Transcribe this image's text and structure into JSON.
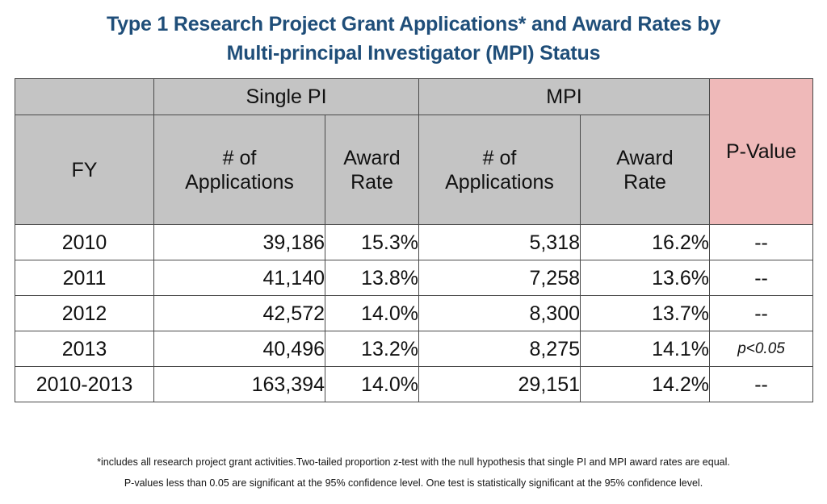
{
  "title": {
    "line1": "Type 1 Research Project Grant Applications* and Award Rates by",
    "line2": "Multi-principal Investigator (MPI) Status"
  },
  "colors": {
    "title_blue": "#1F4E79",
    "header_gray": "#C4C4C4",
    "pvalue_pink": "#EFB9B9",
    "border": "#4a4a4a",
    "cell_background": "#FFFFFF"
  },
  "table": {
    "group_headers": {
      "blank": "",
      "single_pi": "Single PI",
      "mpi": "MPI",
      "p_value": "P-Value"
    },
    "sub_headers": {
      "fy": "FY",
      "single_pi_applications": "# of Applications",
      "single_pi_award_rate": "Award Rate",
      "mpi_applications": "# of Applications",
      "mpi_award_rate": "Award Rate"
    },
    "sub_headers_lines": {
      "spi_app_l1": "# of",
      "spi_app_l2": "Applications",
      "spi_rate_l1": "Award",
      "spi_rate_l2": "Rate",
      "mpi_app_l1": "# of",
      "mpi_app_l2": "Applications",
      "mpi_rate_l1": "Award",
      "mpi_rate_l2": "Rate"
    },
    "rows": [
      {
        "fy": "2010",
        "single_pi_applications": "39,186",
        "single_pi_award_rate": "15.3%",
        "mpi_applications": "5,318",
        "mpi_award_rate": "16.2%",
        "p_value": "--",
        "significant": false
      },
      {
        "fy": "2011",
        "single_pi_applications": "41,140",
        "single_pi_award_rate": "13.8%",
        "mpi_applications": "7,258",
        "mpi_award_rate": "13.6%",
        "p_value": "--",
        "significant": false
      },
      {
        "fy": "2012",
        "single_pi_applications": "42,572",
        "single_pi_award_rate": "14.0%",
        "mpi_applications": "8,300",
        "mpi_award_rate": "13.7%",
        "p_value": "--",
        "significant": false
      },
      {
        "fy": "2013",
        "single_pi_applications": "40,496",
        "single_pi_award_rate": "13.2%",
        "mpi_applications": "8,275",
        "mpi_award_rate": "14.1%",
        "p_value": "p<0.05",
        "significant": true
      },
      {
        "fy": "2010-2013",
        "single_pi_applications": "163,394",
        "single_pi_award_rate": "14.0%",
        "mpi_applications": "29,151",
        "mpi_award_rate": "14.2%",
        "p_value": "--",
        "significant": false
      }
    ]
  },
  "footnote": {
    "line1": "*includes all research project grant activities.Two-tailed proportion z-test with the null hypothesis that single PI and MPI award rates are equal.",
    "line2": "P-values less than 0.05 are significant at the 95% confidence level. One test is statistically significant at the 95% confidence level."
  },
  "chart_data": {
    "type": "table",
    "title": "Type 1 Research Project Grant Applications* and Award Rates by Multi-principal Investigator (MPI) Status",
    "columns": [
      "FY",
      "Single PI # of Applications",
      "Single PI Award Rate",
      "MPI # of Applications",
      "MPI Award Rate",
      "P-Value"
    ],
    "categories": [
      "2010",
      "2011",
      "2012",
      "2013",
      "2010-2013"
    ],
    "series": [
      {
        "name": "Single PI # of Applications",
        "values": [
          39186,
          41140,
          42572,
          40496,
          163394
        ]
      },
      {
        "name": "Single PI Award Rate (%)",
        "values": [
          15.3,
          13.8,
          14.0,
          13.2,
          14.0
        ]
      },
      {
        "name": "MPI # of Applications",
        "values": [
          5318,
          7258,
          8300,
          8275,
          29151
        ]
      },
      {
        "name": "MPI Award Rate (%)",
        "values": [
          16.2,
          13.6,
          13.7,
          14.1,
          14.2
        ]
      },
      {
        "name": "P-Value",
        "values": [
          "--",
          "--",
          "--",
          "p<0.05",
          "--"
        ]
      }
    ],
    "xlabel": "FY",
    "ylabel": ""
  }
}
